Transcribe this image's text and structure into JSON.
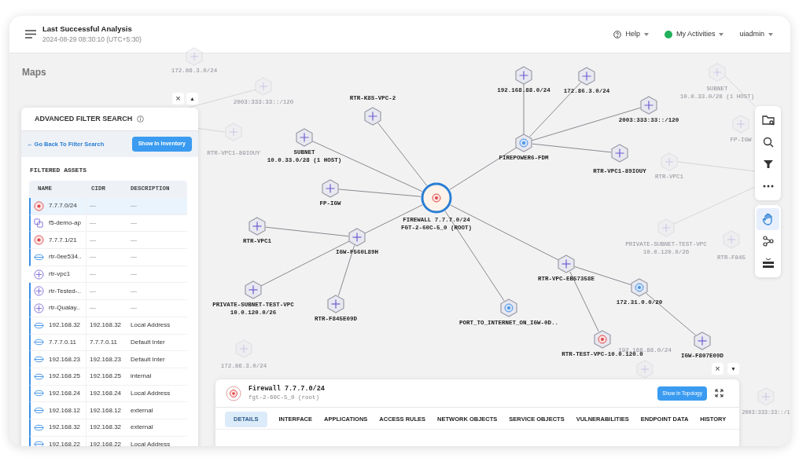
{
  "header": {
    "title": "Last Successful Analysis",
    "timestamp": "2024-08-29 08:30:10 (UTC+5:30)",
    "help": "Help",
    "activities": "My Activities",
    "user": "uiadmin"
  },
  "page_title": "Maps",
  "filter_controls": {
    "close": "×",
    "collapse": "▲"
  },
  "filter_panel": {
    "title": "ADVANCED FILTER SEARCH",
    "back_link": "← Go Back To Filter Search",
    "inventory_button": "Show In Inventory",
    "section": "FILTERED ASSETS",
    "columns": [
      "NAME",
      "CIDR",
      "DESCRIPTION"
    ],
    "rows": [
      {
        "kind": "firewall",
        "name": "7.7.7.0/24",
        "cidr": "—",
        "description": "—",
        "selected": true,
        "marked": true
      },
      {
        "kind": "app",
        "name": "f5-demo-ap",
        "cidr": "—",
        "description": "—",
        "selected": false,
        "marked": true
      },
      {
        "kind": "firewall",
        "name": "7.7.7.1/21",
        "cidr": "—",
        "description": "—",
        "selected": false,
        "marked": true
      },
      {
        "kind": "interface",
        "name": "rtr-0ee534..",
        "cidr": "—",
        "description": "—",
        "selected": false,
        "marked": true
      },
      {
        "kind": "router",
        "name": "rtr-vpc1",
        "cidr": "—",
        "description": "—",
        "selected": false,
        "marked": false
      },
      {
        "kind": "router",
        "name": "rtr-Tested-..",
        "cidr": "—",
        "description": "—",
        "selected": false,
        "marked": true
      },
      {
        "kind": "router",
        "name": "rtr-Qualay..",
        "cidr": "—",
        "description": "—",
        "selected": false,
        "marked": true
      },
      {
        "kind": "interface",
        "name": "192.168.32",
        "cidr": "192.168.32",
        "description": "Local Address",
        "selected": false,
        "marked": true
      },
      {
        "kind": "interface",
        "name": "7.7.7.0.11",
        "cidr": "7.7.7.0.11",
        "description": "Default Inter",
        "selected": false,
        "marked": true
      },
      {
        "kind": "interface",
        "name": "192.168.23",
        "cidr": "192.168.23",
        "description": "Default Inter",
        "selected": false,
        "marked": true
      },
      {
        "kind": "interface",
        "name": "192.168.25",
        "cidr": "192.168.25",
        "description": "internal",
        "selected": false,
        "marked": true
      },
      {
        "kind": "interface",
        "name": "192.168.24",
        "cidr": "192.168.24",
        "description": "Local Address",
        "selected": false,
        "marked": true
      },
      {
        "kind": "interface",
        "name": "192.168.12",
        "cidr": "192.168.12",
        "description": "external",
        "selected": false,
        "marked": true
      },
      {
        "kind": "interface",
        "name": "192.168.32",
        "cidr": "192.168.32",
        "description": "external",
        "selected": false,
        "marked": true
      },
      {
        "kind": "interface",
        "name": "192.168.22",
        "cidr": "192.168.22",
        "description": "Local Address",
        "selected": false,
        "marked": true
      }
    ]
  },
  "topology": {
    "kind": "firewall",
    "label": [
      "FIREWALL 7.7.7.0/24",
      "FGT-2-60C-5_0 (ROOT)"
    ],
    "selected": true,
    "children": [
      {
        "kind": "router",
        "label": [
          "RTR-K8S-VPC-2"
        ],
        "selected": false
      },
      {
        "kind": "router",
        "label": [
          "SUBNET",
          "10.0.33.0/28 (1 HOST)"
        ],
        "selected": false
      },
      {
        "kind": "router",
        "label": [
          "FP-IGW"
        ],
        "selected": false
      },
      {
        "kind": "router",
        "label": [
          "IGW-F560L89H"
        ],
        "selected": false,
        "children": [
          {
            "kind": "router",
            "label": [
              "RTR-VPC1"
            ],
            "selected": false
          },
          {
            "kind": "router",
            "label": [
              "PRIVATE-SUBNET-TEST-VPC",
              "10.0.120.0/26"
            ],
            "selected": false
          },
          {
            "kind": "router",
            "label": [
              "RTR-F845E09D"
            ],
            "selected": false
          }
        ]
      },
      {
        "kind": "network",
        "label": [
          "FIREPOWER6-FDM"
        ],
        "selected": false,
        "children": [
          {
            "kind": "router",
            "label": [
              "192.168.88.0/24"
            ],
            "selected": false
          },
          {
            "kind": "router",
            "label": [
              "172.86.3.0/24"
            ],
            "selected": false
          },
          {
            "kind": "router",
            "label": [
              "2003:333:33::/120"
            ],
            "selected": false
          },
          {
            "kind": "router",
            "label": [
              "RTR-VPC1-89IOUY"
            ],
            "selected": false
          }
        ]
      },
      {
        "kind": "router",
        "label": [
          "RTR-VPC-EB57358E"
        ],
        "selected": false,
        "children": [
          {
            "kind": "firewall",
            "label": [
              "RTR-TEST-VPC-10.0.120.0"
            ],
            "selected": false
          },
          {
            "kind": "network",
            "label": [
              "172.31.0.0/20"
            ],
            "selected": false,
            "children": [
              {
                "kind": "router",
                "label": [
                  "IGW-F807E09D"
                ],
                "selected": false
              }
            ]
          }
        ]
      },
      {
        "kind": "network",
        "label": [
          "PORT_TO_INTERNET_ON_IGW-0D.."
        ],
        "selected": false
      }
    ]
  },
  "background_nodes": [
    {
      "label": [
        "172.86.3.0/24"
      ]
    },
    {
      "label": [
        "2003:333:33::/120"
      ]
    },
    {
      "label": [
        "RTR-VPC1-89IOUY"
      ]
    },
    {
      "label": [
        "SUBNET",
        "10.0.33.0/28 (1 HOST)"
      ]
    },
    {
      "label": [
        "FP-IGW"
      ]
    },
    {
      "label": [
        "RTR-VPC1"
      ]
    },
    {
      "label": [
        "PRIVATE-SUBNET-TEST-VPC",
        "10.0.120.0/26"
      ]
    },
    {
      "label": [
        "192.168.88.0/24"
      ]
    },
    {
      "label": [
        "172.86.3.0/24"
      ]
    },
    {
      "label": [
        "2003:333:33::/1"
      ]
    },
    {
      "label": [
        "RTR-F845"
      ]
    }
  ],
  "toolbar": [
    {
      "kind": "folder-search",
      "selected": false
    },
    {
      "kind": "search",
      "selected": false
    },
    {
      "kind": "filter",
      "selected": false
    },
    {
      "kind": "more",
      "selected": false
    },
    {
      "kind": "hand",
      "selected": true
    },
    {
      "kind": "connect",
      "selected": false
    },
    {
      "kind": "layers",
      "selected": false
    }
  ],
  "detail_controls": {
    "close": "×",
    "expand": "▼"
  },
  "detail_panel": {
    "title": "Firewall 7.7.7.0/24",
    "subtitle": "fgt-2-60C-5_0 (root)",
    "topology_button": "Show in Topology",
    "tabs": [
      {
        "label": "DETAILS",
        "selected": true
      },
      {
        "label": "INTERFACE",
        "selected": false
      },
      {
        "label": "APPLICATIONS",
        "selected": false
      },
      {
        "label": "ACCESS RULES",
        "selected": false
      },
      {
        "label": "NETWORK OBJECTS",
        "selected": false
      },
      {
        "label": "SERVICE OBJECTS",
        "selected": false
      },
      {
        "label": "VULNERABILITIES",
        "selected": false
      },
      {
        "label": "ENDPOINT DATA",
        "selected": false
      },
      {
        "label": "HISTORY",
        "selected": false
      }
    ]
  }
}
